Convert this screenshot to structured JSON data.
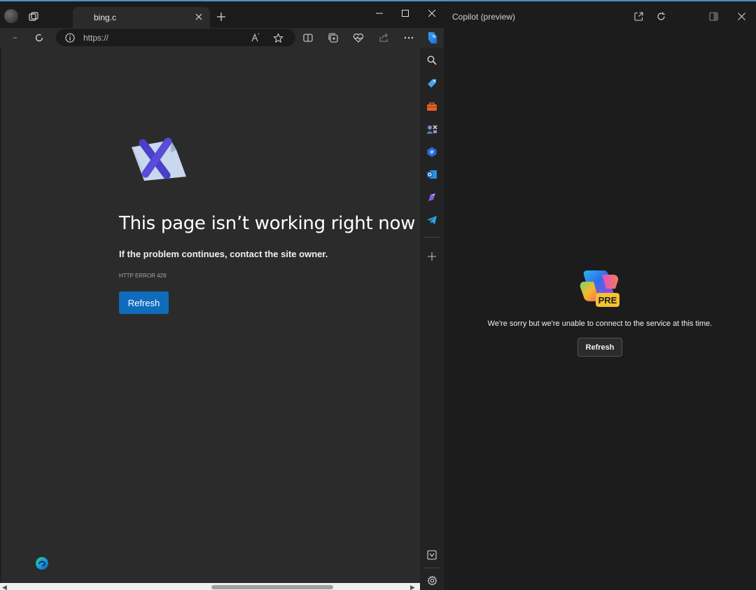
{
  "browser": {
    "tab": {
      "title": "bing.c"
    },
    "address": {
      "url": "https://"
    },
    "page": {
      "title": "This page isn’t working right now",
      "subtitle": "If the problem continues, contact the site owner.",
      "error_code": "HTTP ERROR 429",
      "refresh_label": "Refresh"
    },
    "icons": {
      "profile": "profile-avatar",
      "workspaces": "workspaces-icon",
      "new_tab": "plus-icon",
      "back": "back-arrow-icon",
      "reload": "reload-icon",
      "site_info": "info-icon",
      "read_aloud": "read-aloud-icon",
      "favorite": "star-icon",
      "split_screen": "split-screen-icon",
      "collections": "collections-icon",
      "performance": "heart-pulse-icon",
      "share": "share-icon",
      "more": "more-icon",
      "copilot": "copilot-icon"
    }
  },
  "sidebar": {
    "items": [
      "search-icon",
      "shopping-tag-icon",
      "tools-icon",
      "games-icon",
      "microsoft-365-icon",
      "outlook-icon",
      "drop-icon",
      "telegram-icon",
      "add-icon",
      "screenshot-icon",
      "settings-icon"
    ]
  },
  "copilot": {
    "title": "Copilot (preview)",
    "badge": "PRE",
    "message": "We're sorry but we're unable to connect to the service at this time.",
    "refresh_label": "Refresh"
  },
  "colors": {
    "accent": "#0f6cbd",
    "page_background": "#2b2b2b",
    "pane_background": "#1c1c1c"
  }
}
